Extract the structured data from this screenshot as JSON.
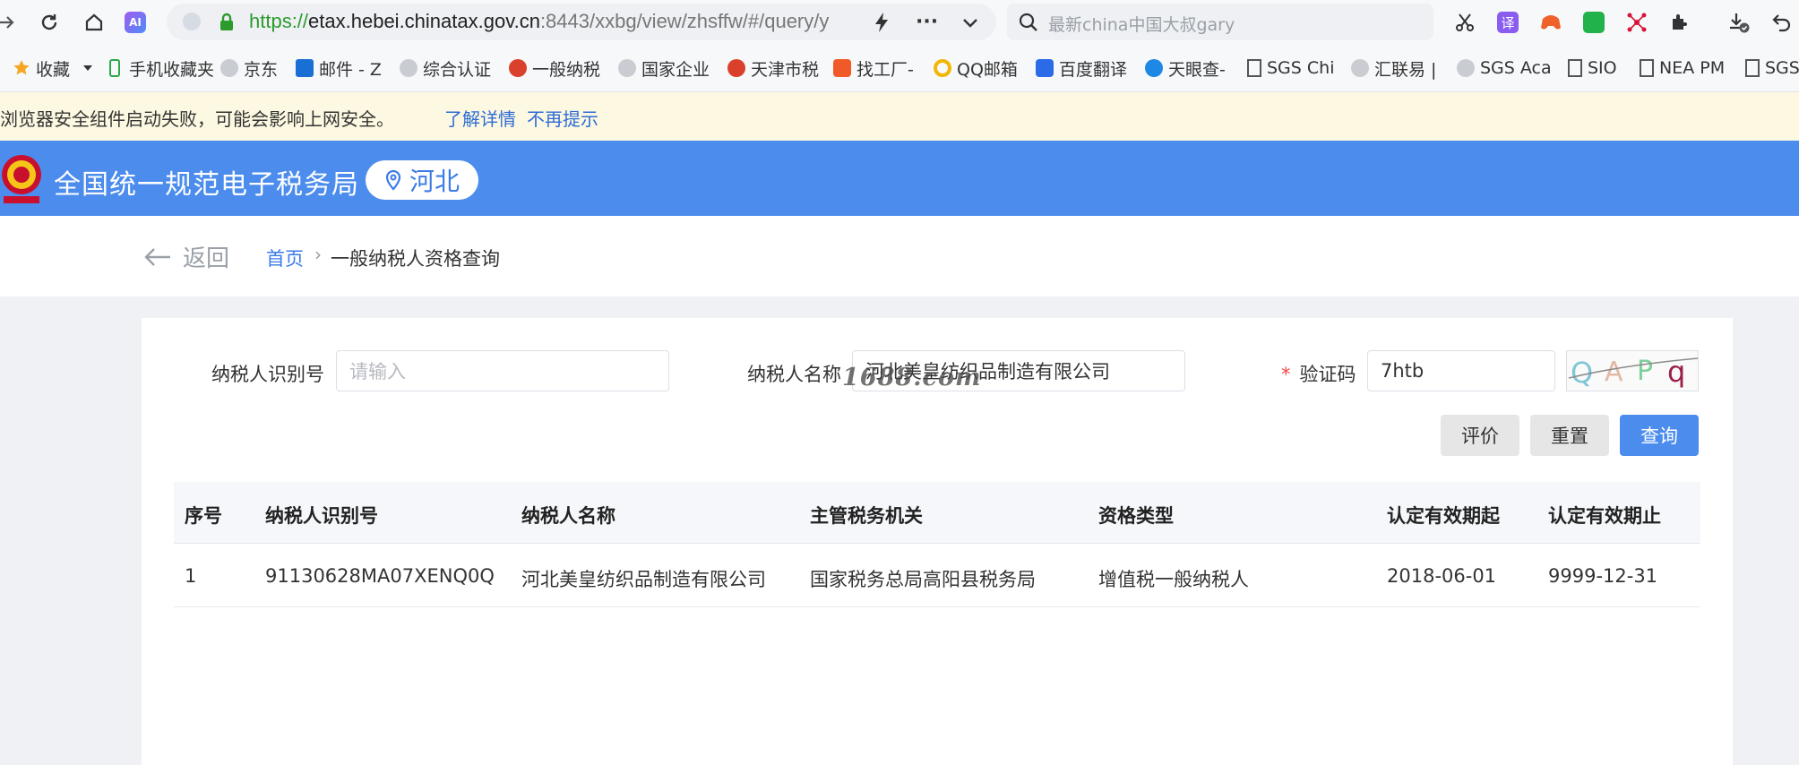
{
  "browser": {
    "url_scheme": "https://",
    "url_host": "etax.hebei.chinatax.gov.cn",
    "url_rest": ":8443/xxbg/view/zhsffw/#/query/y",
    "search_placeholder": "最新china中国大叔gary",
    "ai_badge": "AI",
    "translate_badge": "译"
  },
  "bookmarks": [
    {
      "label": "收藏"
    },
    {
      "label": "手机收藏夹"
    },
    {
      "label": "京东"
    },
    {
      "label": "邮件 - Z"
    },
    {
      "label": "综合认证"
    },
    {
      "label": "一般纳税"
    },
    {
      "label": "国家企业"
    },
    {
      "label": "天津市税"
    },
    {
      "label": "找工厂-"
    },
    {
      "label": "QQ邮箱"
    },
    {
      "label": "百度翻译"
    },
    {
      "label": "天眼查-"
    },
    {
      "label": "SGS Chi"
    },
    {
      "label": "汇联易 |"
    },
    {
      "label": "SGS Aca"
    },
    {
      "label": "SIO"
    },
    {
      "label": "NEA PM"
    },
    {
      "label": "SGS"
    }
  ],
  "banner": {
    "message": "浏览器安全组件启动失败，可能会影响上网安全。",
    "learn_more": "了解详情",
    "dismiss": "不再提示"
  },
  "header": {
    "title": "全国统一规范电子税务局",
    "region": "河北"
  },
  "breadcrumb": {
    "back": "返回",
    "home": "首页",
    "separator": "›",
    "current": "一般纳税人资格查询"
  },
  "form": {
    "taxpayer_id_label": "纳税人识别号",
    "taxpayer_id_placeholder": "请输入",
    "taxpayer_name_label": "纳税人名称",
    "taxpayer_name_value": "河北美皇纺织品制造有限公司",
    "captcha_required_mark": "*",
    "captcha_label": "验证码",
    "captcha_value": "7htb",
    "captcha_chars": [
      "Q",
      "A",
      "P",
      "q"
    ]
  },
  "buttons": {
    "evaluate": "评价",
    "reset": "重置",
    "query": "查询"
  },
  "watermark": "1688.com",
  "table": {
    "headers": [
      "序号",
      "纳税人识别号",
      "纳税人名称",
      "主管税务机关",
      "资格类型",
      "认定有效期起",
      "认定有效期止"
    ],
    "rows": [
      [
        "1",
        "91130628MA07XENQ0Q",
        "河北美皇纺织品制造有限公司",
        "国家税务总局高阳县税务局",
        "增值税一般纳税人",
        "2018-06-01",
        "9999-12-31"
      ]
    ]
  },
  "colors": {
    "header_blue": "#4b8ced",
    "link_blue": "#3b7be8",
    "banner_bg": "#fdf8e1",
    "required_red": "#f04848"
  }
}
